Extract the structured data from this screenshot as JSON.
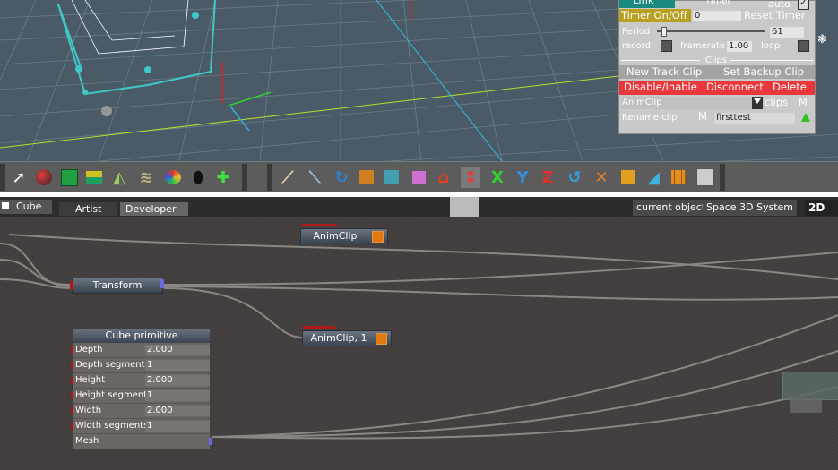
{
  "clip_panel": {
    "link_label": "Link",
    "timer_title": "Timer",
    "auto_label": "auto",
    "timer_onoff": "Timer On/Off",
    "timer_value": "0",
    "reset_timer": "Reset Timer",
    "period_label": "Period",
    "period_value": "61",
    "record_label": "record",
    "framerate_label": "framerate",
    "framerate_value": "1.00",
    "loop_label": "loop",
    "clips_title": "Clips",
    "new_track_clip": "New Track Clip",
    "set_backup_clip": "Set Backup Clip",
    "disable_inable": "Disable/Inable",
    "disconnect": "Disconnect",
    "delete": "Delete",
    "clip_select": "AnimClip",
    "clips_label": "clips",
    "m_label": "M",
    "rename_label": "Rename clip",
    "rename_m": "M",
    "rename_value": "firsttest"
  },
  "tabs": {
    "object_name": "Cube",
    "artist": "Artist",
    "developer": "Developer",
    "current_object": "current object",
    "space3d": "Space 3D",
    "system": "System",
    "mode_2d": "2D"
  },
  "toolbar": {
    "icons_left": [
      "arrow-select-icon",
      "sphere-icon",
      "cube-green-icon",
      "layers-icon",
      "terrain-icon",
      "brush-icon",
      "palette-icon",
      "tire-icon",
      "bone-add-icon"
    ],
    "icons_right": [
      "bone-icon",
      "joint-icon",
      "rotate-icon",
      "box-orange-icon",
      "panel-icon",
      "pink-cube-icon",
      "house-icon",
      "axis-move-icon",
      "x-axis-icon",
      "y-axis-icon",
      "z-axis-icon",
      "rotate-cw-icon",
      "scale-icon",
      "crate-icon",
      "cone-icon",
      "grid-box-icon",
      "render-icon"
    ],
    "x_label": "X",
    "y_label": "Y",
    "z_label": "Z"
  },
  "graph": {
    "animclip_node": "AnimClip",
    "transform_node": "Transform",
    "animclip1_node": "AnimClip, 1",
    "cube_primitive": {
      "title": "Cube primitive",
      "params": [
        {
          "name": "Depth",
          "value": "2.000"
        },
        {
          "name": "Depth segments",
          "value": "1"
        },
        {
          "name": "Height",
          "value": "2.000"
        },
        {
          "name": "Height segment",
          "value": "1"
        },
        {
          "name": "Width",
          "value": "2.000"
        },
        {
          "name": "Width segments",
          "value": "1"
        },
        {
          "name": "Mesh",
          "value": ""
        }
      ]
    }
  },
  "colors": {
    "accent_red": "#e8383c",
    "timer_yellow": "#b8a020",
    "link_teal": "#1a8a80",
    "node_orange": "#e07a10"
  }
}
